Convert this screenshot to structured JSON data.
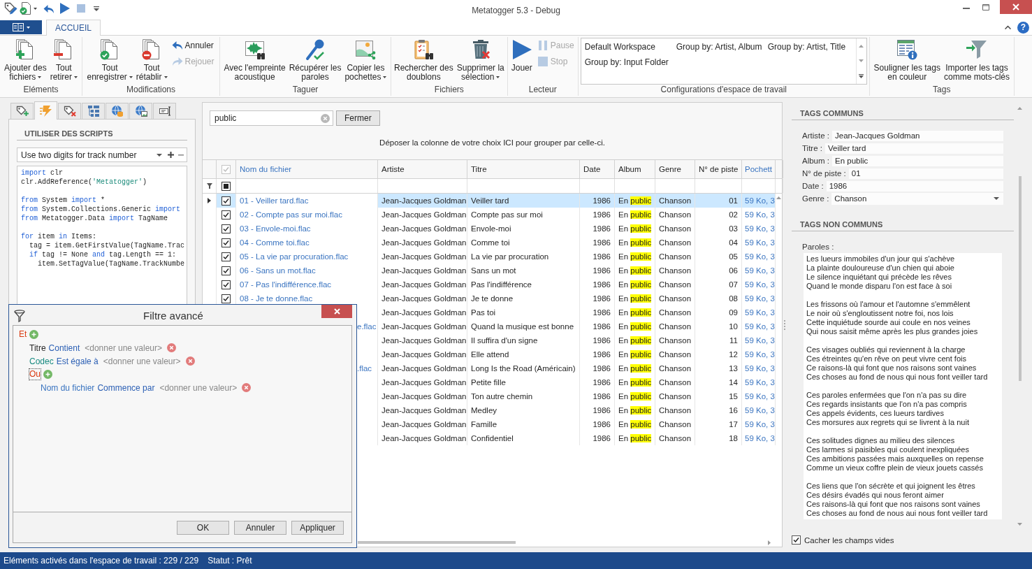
{
  "window": {
    "title": "Metatogger 5.3 - Debug"
  },
  "ribbon_tabs": [
    {
      "label": "ACCUEIL",
      "selected": true
    }
  ],
  "help_button": "?",
  "ribbon_groups": [
    {
      "label": "Eléments",
      "items": [
        {
          "kind": "large",
          "lines": [
            "Ajouter des",
            "fichiers"
          ],
          "menu": true
        },
        {
          "kind": "large",
          "lines": [
            "Tout",
            "retirer"
          ],
          "menu": true
        }
      ]
    },
    {
      "label": "Modifications",
      "items": [
        {
          "kind": "large",
          "lines": [
            "Tout",
            "enregistrer"
          ],
          "menu": true
        },
        {
          "kind": "large",
          "lines": [
            "Tout",
            "rétablir"
          ],
          "menu": true
        },
        {
          "kind": "small",
          "buttons": [
            {
              "label": "Annuler",
              "disabled": false
            },
            {
              "label": "Rejouer",
              "disabled": true
            }
          ]
        }
      ]
    },
    {
      "label": "Taguer",
      "items": [
        {
          "kind": "large",
          "lines": [
            "Avec l'empreinte",
            "acoustique"
          ],
          "menu": false
        },
        {
          "kind": "large",
          "lines": [
            "Récupérer les",
            "paroles"
          ],
          "menu": false
        },
        {
          "kind": "large",
          "lines": [
            "Copier les",
            "pochettes"
          ],
          "menu": true
        }
      ]
    },
    {
      "label": "Fichiers",
      "items": [
        {
          "kind": "large",
          "lines": [
            "Rechercher des",
            "doublons"
          ],
          "menu": false
        },
        {
          "kind": "large",
          "lines": [
            "Supprimer la",
            "sélection"
          ],
          "menu": true
        }
      ]
    },
    {
      "label": "Lecteur",
      "items": [
        {
          "kind": "large",
          "lines": [
            "Jouer"
          ],
          "menu": false
        },
        {
          "kind": "small",
          "buttons": [
            {
              "label": "Pause",
              "disabled": true
            },
            {
              "label": "Stop",
              "disabled": true
            }
          ]
        }
      ]
    },
    {
      "label": "Configurations d'espace de travail",
      "items": [
        {
          "kind": "gallery",
          "entries": [
            "Default Workspace",
            "Group by: Artist, Album",
            "Group by: Artist, Title",
            "Group by: Input Folder"
          ]
        }
      ]
    },
    {
      "label": "Tags",
      "items": [
        {
          "kind": "large",
          "lines": [
            "Souligner les tags",
            "en couleur"
          ],
          "menu": false
        },
        {
          "kind": "large",
          "lines": [
            "Importer les tags",
            "comme mots-clés"
          ],
          "menu": false
        }
      ]
    }
  ],
  "side_tabs": [
    {
      "selected": false
    },
    {
      "selected": true
    },
    {
      "selected": false
    },
    {
      "selected": false
    },
    {
      "selected": false
    },
    {
      "selected": false
    },
    {
      "selected": false
    }
  ],
  "scripts_panel": {
    "title": "UTILISER DES SCRIPTS",
    "script": "Use two digits for track number",
    "code": [
      [
        [
          {
            "text": "import",
            "kind": "keyword"
          },
          {
            "text": " clr",
            "kind": "plain"
          }
        ],
        [
          {
            "text": "clr.AddReference(",
            "kind": "plain"
          },
          {
            "text": "'Metatogger'",
            "kind": "string"
          },
          {
            "text": ")",
            "kind": "plain"
          }
        ]
      ],
      [
        [
          {
            "text": "from",
            "kind": "keyword"
          },
          {
            "text": " System ",
            "kind": "plain"
          },
          {
            "text": "import",
            "kind": "keyword"
          },
          {
            "text": " *",
            "kind": "plain"
          }
        ],
        [
          {
            "text": "from",
            "kind": "keyword"
          },
          {
            "text": " System.Collections.Generic ",
            "kind": "plain"
          },
          {
            "text": "import",
            "kind": "keyword"
          }
        ],
        [
          {
            "text": "from",
            "kind": "keyword"
          },
          {
            "text": " Metatogger.Data ",
            "kind": "plain"
          },
          {
            "text": "import",
            "kind": "keyword"
          },
          {
            "text": " TagName",
            "kind": "plain"
          }
        ]
      ],
      [
        [
          {
            "text": "for",
            "kind": "keyword"
          },
          {
            "text": " item ",
            "kind": "plain"
          },
          {
            "text": "in",
            "kind": "keyword"
          },
          {
            "text": " Items:",
            "kind": "plain"
          }
        ],
        [
          {
            "text": "  tag = item.GetFirstValue(TagName.Trac",
            "kind": "plain"
          }
        ],
        [
          {
            "text": "  if",
            "kind": "keyword"
          },
          {
            "text": " tag != None ",
            "kind": "plain"
          },
          {
            "text": "and",
            "kind": "keyword"
          },
          {
            "text": " tag.Length == 1:",
            "kind": "plain"
          }
        ],
        [
          {
            "text": "    item.SetTagValue(TagName.TrackNumbe",
            "kind": "plain"
          }
        ]
      ]
    ]
  },
  "search": {
    "value": "public",
    "close_button": "Fermer"
  },
  "group_hint": "Déposer la colonne de votre choix ICI pour grouper par celle-ci.",
  "table": {
    "select_all": {
      "checked": true,
      "disabled": true
    },
    "filter_check": {
      "indeterminate": true
    },
    "columns": [
      {
        "label": "Nom du fichier",
        "kind": "property"
      },
      {
        "label": "Artiste",
        "kind": "tag"
      },
      {
        "label": "Titre",
        "kind": "tag"
      },
      {
        "label": "Date",
        "kind": "tag"
      },
      {
        "label": "Album",
        "kind": "tag"
      },
      {
        "label": "Genre",
        "kind": "tag"
      },
      {
        "label": "N° de piste",
        "kind": "tag"
      },
      {
        "label": "Pochett",
        "kind": "property"
      }
    ],
    "rows": [
      {
        "selected": true,
        "checked": true,
        "file_name": "01 - Veiller tard.flac",
        "file_name_cut": false,
        "artist": "Jean-Jacques Goldman",
        "title": "Veiller tard",
        "date": "1986",
        "album": {
          "before": "En",
          "highlight": "public"
        },
        "genre": "Chanson",
        "track": "01",
        "cover": "59 Ko, 3"
      },
      {
        "selected": false,
        "checked": true,
        "file_name": "02 - Compte pas sur moi.flac",
        "file_name_cut": false,
        "artist": "Jean-Jacques Goldman",
        "title": "Compte pas sur moi",
        "date": "1986",
        "album": {
          "before": "En",
          "highlight": "public"
        },
        "genre": "Chanson",
        "track": "02",
        "cover": "59 Ko, 3"
      },
      {
        "selected": false,
        "checked": true,
        "file_name": "03 - Envole-moi.flac",
        "file_name_cut": false,
        "artist": "Jean-Jacques Goldman",
        "title": "Envole-moi",
        "date": "1986",
        "album": {
          "before": "En",
          "highlight": "public"
        },
        "genre": "Chanson",
        "track": "03",
        "cover": "59 Ko, 3"
      },
      {
        "selected": false,
        "checked": true,
        "file_name": "04 - Comme toi.flac",
        "file_name_cut": false,
        "artist": "Jean-Jacques Goldman",
        "title": "Comme toi",
        "date": "1986",
        "album": {
          "before": "En",
          "highlight": "public"
        },
        "genre": "Chanson",
        "track": "04",
        "cover": "59 Ko, 3"
      },
      {
        "selected": false,
        "checked": true,
        "file_name": "05 - La vie par procuration.flac",
        "file_name_cut": false,
        "artist": "Jean-Jacques Goldman",
        "title": "La vie par procuration",
        "date": "1986",
        "album": {
          "before": "En",
          "highlight": "public"
        },
        "genre": "Chanson",
        "track": "05",
        "cover": "59 Ko, 3"
      },
      {
        "selected": false,
        "checked": true,
        "file_name": "06 - Sans un mot.flac",
        "file_name_cut": false,
        "artist": "Jean-Jacques Goldman",
        "title": "Sans un mot",
        "date": "1986",
        "album": {
          "before": "En",
          "highlight": "public"
        },
        "genre": "Chanson",
        "track": "06",
        "cover": "59 Ko, 3"
      },
      {
        "selected": false,
        "checked": true,
        "file_name": "07 - Pas l'indifférence.flac",
        "file_name_cut": false,
        "artist": "Jean-Jacques Goldman",
        "title": "Pas l'indifférence",
        "date": "1986",
        "album": {
          "before": "En",
          "highlight": "public"
        },
        "genre": "Chanson",
        "track": "07",
        "cover": "59 Ko, 3"
      },
      {
        "selected": false,
        "checked": true,
        "file_name": "08 - Je te donne.flac",
        "file_name_cut": false,
        "artist": "Jean-Jacques Goldman",
        "title": "Je te donne",
        "date": "1986",
        "album": {
          "before": "En",
          "highlight": "public"
        },
        "genre": "Chanson",
        "track": "08",
        "cover": "59 Ko, 3"
      },
      {
        "selected": false,
        "artist": "Jean-Jacques Goldman",
        "title": "Pas toi",
        "date": "1986",
        "album": {
          "before": "En",
          "highlight": "public"
        },
        "genre": "Chanson",
        "track": "09",
        "cover": "59 Ko, 3"
      },
      {
        "selected": false,
        "file_name": "e.flac",
        "file_name_cut": true,
        "artist": "Jean-Jacques Goldman",
        "title": "Quand la musique est bonne",
        "date": "1986",
        "album": {
          "before": "En",
          "highlight": "public"
        },
        "genre": "Chanson",
        "track": "10",
        "cover": "59 Ko, 3"
      },
      {
        "selected": false,
        "artist": "Jean-Jacques Goldman",
        "title": "Il suffira d'un signe",
        "date": "1986",
        "album": {
          "before": "En",
          "highlight": "public"
        },
        "genre": "Chanson",
        "track": "11",
        "cover": "59 Ko, 3"
      },
      {
        "selected": false,
        "artist": "Jean-Jacques Goldman",
        "title": "Elle attend",
        "date": "1986",
        "album": {
          "before": "En",
          "highlight": "public"
        },
        "genre": "Chanson",
        "track": "12",
        "cover": "59 Ko, 3"
      },
      {
        "selected": false,
        "file_name": ".flac",
        "file_name_cut": true,
        "artist": "Jean-Jacques Goldman",
        "title": "Long Is the Road (Américain)",
        "date": "1986",
        "album": {
          "before": "En",
          "highlight": "public"
        },
        "genre": "Chanson",
        "track": "13",
        "cover": "59 Ko, 3"
      },
      {
        "selected": false,
        "artist": "Jean-Jacques Goldman",
        "title": "Petite fille",
        "date": "1986",
        "album": {
          "before": "En",
          "highlight": "public"
        },
        "genre": "Chanson",
        "track": "14",
        "cover": "59 Ko, 3"
      },
      {
        "selected": false,
        "artist": "Jean-Jacques Goldman",
        "title": "Ton autre chemin",
        "date": "1986",
        "album": {
          "before": "En",
          "highlight": "public"
        },
        "genre": "Chanson",
        "track": "15",
        "cover": "59 Ko, 3"
      },
      {
        "selected": false,
        "artist": "Jean-Jacques Goldman",
        "title": "Medley",
        "date": "1986",
        "album": {
          "before": "En",
          "highlight": "public"
        },
        "genre": "Chanson",
        "track": "16",
        "cover": "59 Ko, 3"
      },
      {
        "selected": false,
        "artist": "Jean-Jacques Goldman",
        "title": "Famille",
        "date": "1986",
        "album": {
          "before": "En",
          "highlight": "public"
        },
        "genre": "Chanson",
        "track": "17",
        "cover": "59 Ko, 3"
      },
      {
        "selected": false,
        "artist": "Jean-Jacques Goldman",
        "title": "Confidentiel",
        "date": "1986",
        "album": {
          "before": "En",
          "highlight": "public"
        },
        "genre": "Chanson",
        "track": "18",
        "cover": "59 Ko, 3"
      }
    ]
  },
  "common_tags": {
    "title": "TAGS COMMUNS",
    "fields": [
      {
        "kind": "text",
        "label": "Artiste :",
        "value": "Jean-Jacques Goldman"
      },
      {
        "kind": "text",
        "label": "Titre :",
        "value": "Veiller tard"
      },
      {
        "kind": "text",
        "label": "Album :",
        "value": "En public"
      },
      {
        "kind": "text",
        "label": "N° de piste :",
        "value": "01"
      },
      {
        "kind": "text",
        "label": "Date :",
        "value": "1986"
      },
      {
        "kind": "dropdown",
        "label": "Genre :",
        "value": "Chanson"
      }
    ]
  },
  "uncommon_tags": {
    "title": "TAGS NON COMMUNS",
    "lyrics_label": "Paroles :",
    "lyrics": "Les lueurs immobiles d'un jour qui s'achève\nLa plainte douloureuse d'un chien qui aboie\nLe silence inquiétant qui précède les rêves\nQuand le monde disparu l'on est face à soi\n\nLes frissons où l'amour et l'automne s'emmêlent\nLe noir où s'engloutissent notre foi, nos lois\nCette inquiétude sourde aui coule en nos veines\nQui nous saisit même après les plus grandes joies\n\nCes visages oubliés qui reviennent à la charge\nCes étreintes qu'en rêve on peut vivre cent fois\nCe raisons-là qui font que nos raisons sont vaines\nCes choses au fond de nous qui nous font veiller tard\n\nCes paroles enfermées que l'on n'a pas su dire\nCes regards insistants que l'on n'a pas compris\nCes appels évidents, ces lueurs tardives\nCes morsures aux regrets qui se livrent à la nuit\n\nCes solitudes dignes au milieu des silences\nCes larmes si paisibles qui coulent inexpliquées\nCes ambitions passées mais auxquelles on repense\nComme un vieux coffre plein de vieux jouets cassés\n\nCes liens que l'on sécrète et qui joignent les êtres\nCes désirs évadés qui nous feront aimer\nCes raisons-là qui font que nos raisons sont vaines\nCes choses au fond de nous aui nous font veiller tard"
  },
  "hide_empty_fields": {
    "label": "Cacher les champs vides",
    "checked": true
  },
  "filter_dialog": {
    "title": "Filtre avancé",
    "root": {
      "operator": "Et",
      "focused": false,
      "children": [
        {
          "kind": "condition",
          "field": "Titre",
          "color": "#262626",
          "operator": "Contient",
          "value_prompt": "<donner une valeur>"
        },
        {
          "kind": "condition",
          "field": "Codec",
          "color": "#178a80",
          "operator": "Est égale à",
          "value_prompt": "<donner une valeur>"
        },
        {
          "kind": "group",
          "operator": "Ou",
          "focused": true,
          "children": [
            {
              "kind": "condition",
              "field": "Nom du fichier",
              "color": "#3a74c0",
              "operator": "Commence par",
              "value_prompt": "<donner une valeur>"
            }
          ]
        }
      ]
    },
    "buttons": [
      "OK",
      "Annuler",
      "Appliquer"
    ]
  },
  "status_bar": {
    "items": [
      "Eléments activés dans l'espace de travail : 229 / 229",
      "Statut : Prêt"
    ]
  }
}
